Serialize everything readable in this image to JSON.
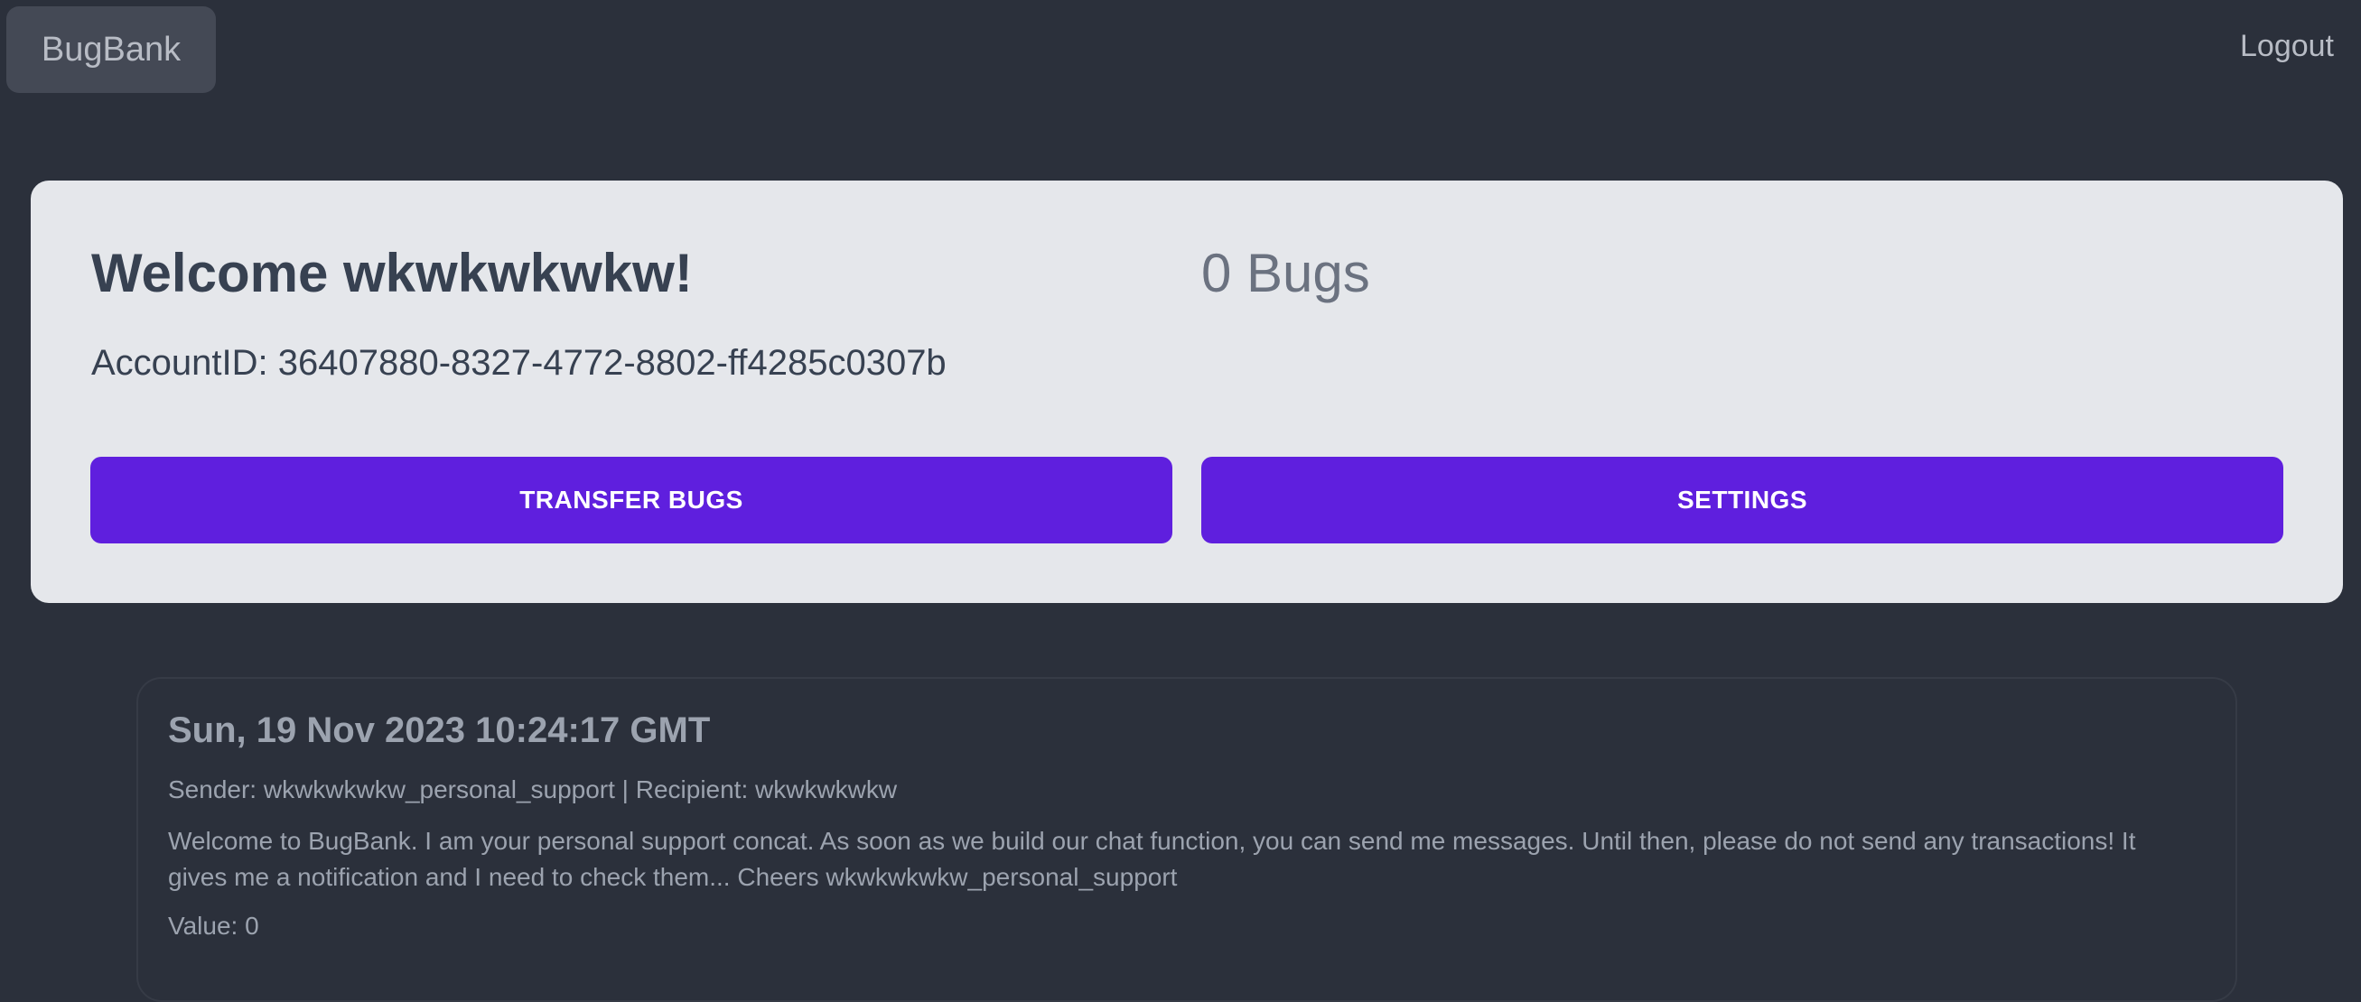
{
  "header": {
    "brand": "BugBank",
    "logout_label": "Logout"
  },
  "account": {
    "welcome": "Welcome wkwkwkwkw!",
    "balance": "0 Bugs",
    "account_id": "AccountID: 36407880-8327-4772-8802-ff4285c0307b",
    "transfer_label": "TRANSFER BUGS",
    "settings_label": "SETTINGS"
  },
  "messages": [
    {
      "date": "Sun, 19 Nov 2023 10:24:17 GMT",
      "meta": "Sender: wkwkwkwkw_personal_support | Recipient: wkwkwkwkw",
      "body": "Welcome to BugBank. I am your personal support concat. As soon as we build our chat function, you can send me messages. Until then, please do not send any transactions! It gives me a notification and I need to check them... Cheers wkwkwkwkw_personal_support",
      "value": "Value: 0"
    }
  ],
  "colors": {
    "background": "#2b303b",
    "card": "#e5e7eb",
    "accent": "#5f1fde",
    "muted_text": "#9ca3af"
  }
}
